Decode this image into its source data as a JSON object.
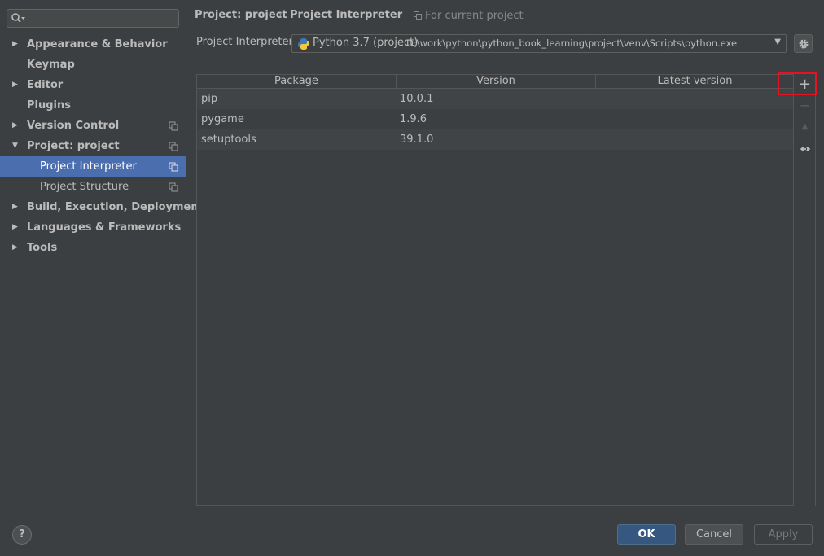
{
  "sidebar": {
    "items": [
      {
        "label": "Appearance & Behavior",
        "arrow": "▶"
      },
      {
        "label": "Keymap"
      },
      {
        "label": "Editor",
        "arrow": "▶"
      },
      {
        "label": "Plugins"
      },
      {
        "label": "Version Control",
        "arrow": "▶"
      },
      {
        "label": "Project: project",
        "arrow": "▼"
      },
      {
        "label": "Project Interpreter"
      },
      {
        "label": "Project Structure"
      },
      {
        "label": "Build, Execution, Deployment",
        "arrow": "▶"
      },
      {
        "label": "Languages & Frameworks",
        "arrow": "▶"
      },
      {
        "label": "Tools",
        "arrow": "▶"
      }
    ],
    "selected": "Project Interpreter"
  },
  "header": {
    "breadcrumb_parent": "Project: project",
    "breadcrumb_sep": "›",
    "breadcrumb_current": "Project Interpreter",
    "scope_note": "For current project"
  },
  "interpreter": {
    "label": "Project Interpreter:",
    "name": "Python 3.7 (project)",
    "path": "D:\\work\\python\\python_book_learning\\project\\venv\\Scripts\\python.exe",
    "dropdown_arrow": "▼"
  },
  "table": {
    "columns": [
      "Package",
      "Version",
      "Latest version"
    ],
    "rows": [
      {
        "package": "pip",
        "version": "10.0.1",
        "latest": ""
      },
      {
        "package": "pygame",
        "version": "1.9.6",
        "latest": ""
      },
      {
        "package": "setuptools",
        "version": "39.1.0",
        "latest": ""
      }
    ]
  },
  "toolbar": {
    "add_label": "+",
    "remove_label": "−",
    "upgrade_label": "▲",
    "show_icon": "eye-icon"
  },
  "footer": {
    "help_label": "?",
    "ok_label": "OK",
    "cancel_label": "Cancel",
    "apply_label": "Apply"
  },
  "colors": {
    "background": "#3c3f41",
    "selection": "#4b6eaf",
    "primary_button": "#365880",
    "highlight_box": "#e81123"
  }
}
